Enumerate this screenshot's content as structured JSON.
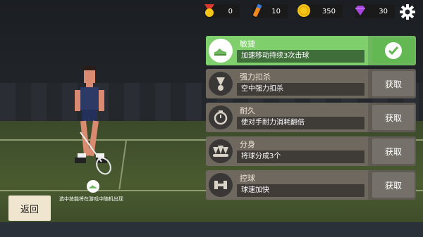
{
  "resources": [
    {
      "name": "medal-icon",
      "value": "0"
    },
    {
      "name": "shuttle-tube-icon",
      "value": "10"
    },
    {
      "name": "coin-icon",
      "value": "350"
    },
    {
      "name": "diamond-icon",
      "value": "30"
    }
  ],
  "skills": [
    {
      "id": "agility",
      "title": "敏捷",
      "desc": "加速移动持续3次击球",
      "action": "",
      "active": true,
      "icon": "shoe-icon"
    },
    {
      "id": "power-smash",
      "title": "强力扣杀",
      "desc": "空中强力扣杀",
      "action": "获取",
      "active": false,
      "icon": "shuttlecock-icon"
    },
    {
      "id": "endurance",
      "title": "耐久",
      "desc": "使对手耐力消耗翻倍",
      "action": "获取",
      "active": false,
      "icon": "stopwatch-icon"
    },
    {
      "id": "split",
      "title": "分身",
      "desc": "将球分成3个",
      "action": "获取",
      "active": false,
      "icon": "split-shuttle-icon"
    },
    {
      "id": "control",
      "title": "控球",
      "desc": "球速加快",
      "action": "获取",
      "active": false,
      "icon": "dumbbell-icon"
    }
  ],
  "hint": "选中技能将在游戏中随机出现",
  "back_label": "返回",
  "colors": {
    "active_green": "#6fb75e",
    "card_grey": "#5f5a53",
    "back_bg": "#f0e6cf"
  }
}
